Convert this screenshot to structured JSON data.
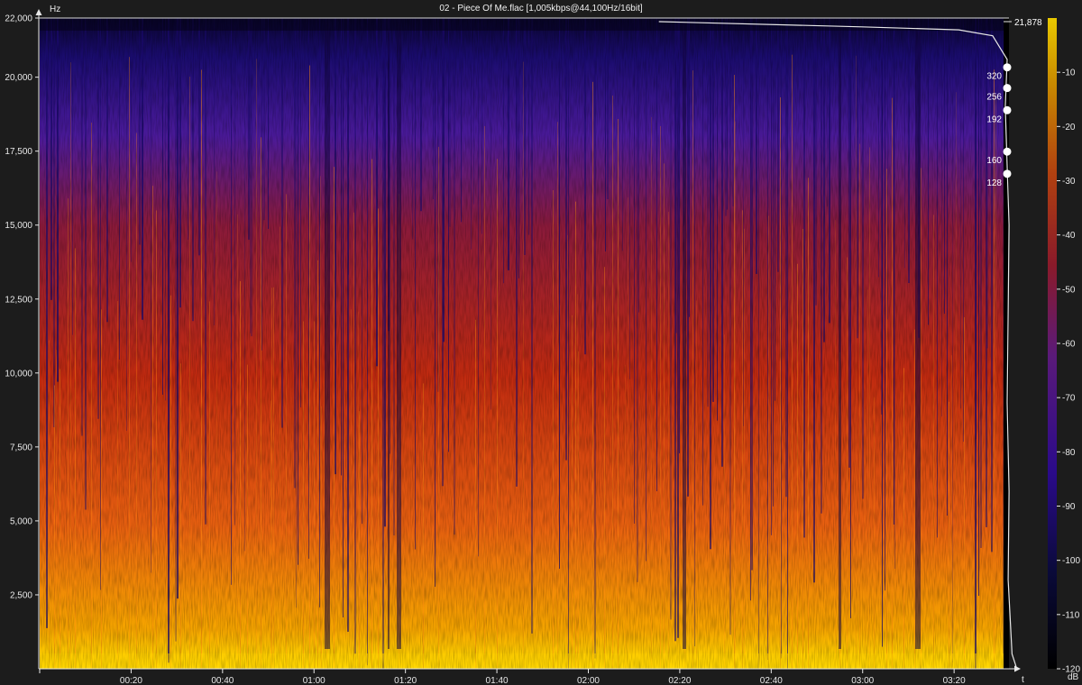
{
  "window": {
    "title": "02 - Piece Of Me.flac [1,005kbps@44,100Hz/16bit]"
  },
  "colors": {
    "background": "#1c1c1c",
    "axis": "#e8e8e8",
    "gradient": [
      "#050510",
      "#1a0c6e",
      "#4a1a9a",
      "#8a1a3a",
      "#c02a10",
      "#e86010",
      "#f5a500",
      "#ffe000"
    ]
  },
  "chart_data": {
    "type": "heatmap",
    "title": "02 - Piece Of Me.flac [1,005kbps@44,100Hz/16bit]",
    "xlabel": "t",
    "ylabel": "Hz",
    "x_ticks": [
      "00:20",
      "00:40",
      "01:00",
      "01:20",
      "01:40",
      "02:00",
      "02:20",
      "02:40",
      "03:00",
      "03:20"
    ],
    "x_tick_seconds": [
      20,
      40,
      60,
      80,
      100,
      120,
      140,
      160,
      180,
      200
    ],
    "xlim_seconds": [
      0,
      212
    ],
    "y_ticks": [
      "2,500",
      "5,000",
      "7,500",
      "10,000",
      "12,500",
      "15,000",
      "17,500",
      "20,000",
      "22,000"
    ],
    "y_tick_values": [
      2500,
      5000,
      7500,
      10000,
      12500,
      15000,
      17500,
      20000,
      22000
    ],
    "ylim": [
      0,
      22000
    ],
    "cutoff_label": "21,878",
    "cutoff_hz": 21878,
    "bitrate_markers": [
      {
        "label": "320",
        "hz": 20150
      },
      {
        "label": "256",
        "hz": 19450
      },
      {
        "label": "192",
        "hz": 18700
      },
      {
        "label": "160",
        "hz": 17300
      },
      {
        "label": "128",
        "hz": 16550
      }
    ],
    "colorbar": {
      "label": "dB",
      "ticks": [
        "-10",
        "-20",
        "-30",
        "-40",
        "-50",
        "-60",
        "-70",
        "-80",
        "-90",
        "-100",
        "-110",
        "-120"
      ],
      "tick_values": [
        -10,
        -20,
        -30,
        -40,
        -50,
        -60,
        -70,
        -80,
        -90,
        -100,
        -110,
        -120
      ],
      "range": [
        -120,
        0
      ]
    },
    "spectrum_profile": [
      {
        "hz": 21878,
        "x_frac": 0.64
      },
      {
        "hz": 21700,
        "x_frac": 0.85
      },
      {
        "hz": 21600,
        "x_frac": 0.95
      },
      {
        "hz": 21400,
        "x_frac": 0.985
      },
      {
        "hz": 20600,
        "x_frac": 1.0
      },
      {
        "hz": 19000,
        "x_frac": 0.998
      },
      {
        "hz": 17000,
        "x_frac": 1.0
      },
      {
        "hz": 15000,
        "x_frac": 1.002
      },
      {
        "hz": 12000,
        "x_frac": 1.001
      },
      {
        "hz": 9000,
        "x_frac": 1.0
      },
      {
        "hz": 6000,
        "x_frac": 1.002
      },
      {
        "hz": 3000,
        "x_frac": 1.001
      },
      {
        "hz": 500,
        "x_frac": 1.005
      },
      {
        "hz": 0,
        "x_frac": 1.01
      }
    ]
  }
}
